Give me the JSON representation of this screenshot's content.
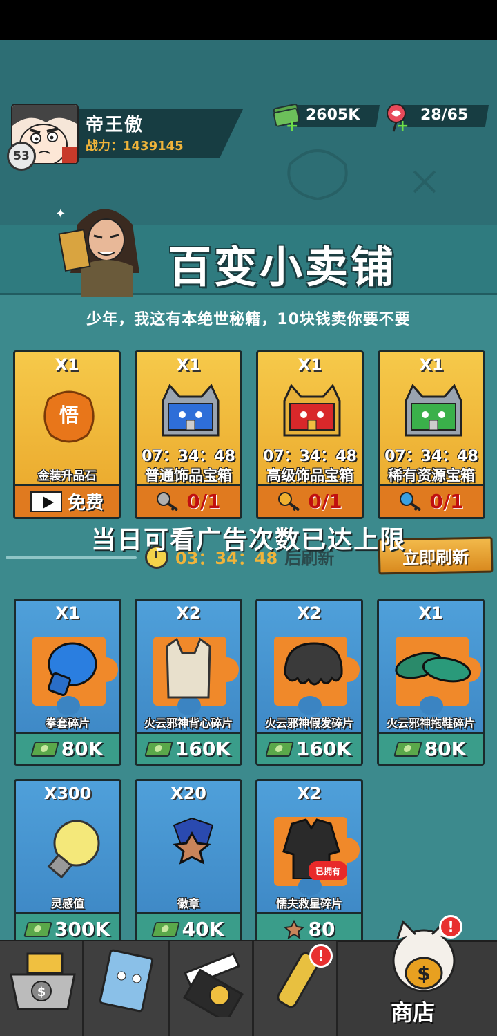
{
  "player": {
    "name": "帝王傲",
    "power_label": "战力：",
    "power": "1439145",
    "level": "53"
  },
  "resources": {
    "cash": "2605K",
    "lollipop": "28/65"
  },
  "shop": {
    "title": "百变小卖铺",
    "subtitle": "少年，我这有本绝世秘籍，10块钱卖你要不要",
    "special_items": [
      {
        "qty": "X1",
        "name": "金装升品石",
        "timer": "",
        "footer": "免费",
        "footer_type": "ad"
      },
      {
        "qty": "X1",
        "name": "普通饰品宝箱",
        "timer": "07：34：48",
        "footer": "0/1",
        "footer_type": "key",
        "key_color": "#b0b0b0"
      },
      {
        "qty": "X1",
        "name": "高级饰品宝箱",
        "timer": "07：34：48",
        "footer": "0/1",
        "footer_type": "key",
        "key_color": "#f0b030"
      },
      {
        "qty": "X1",
        "name": "稀有资源宝箱",
        "timer": "07：34：48",
        "footer": "0/1",
        "footer_type": "key",
        "key_color": "#3aa0e0"
      }
    ],
    "notice": "当日可看广告次数已达上限",
    "refresh_timer": "03：34：48",
    "refresh_label": "后刷新",
    "refresh_button": "立即刷新",
    "items": [
      {
        "qty": "X1",
        "name": "拳套碎片",
        "price": "80K"
      },
      {
        "qty": "X2",
        "name": "火云邪神背心碎片",
        "price": "160K"
      },
      {
        "qty": "X2",
        "name": "火云邪神假发碎片",
        "price": "160K"
      },
      {
        "qty": "X1",
        "name": "火云邪神拖鞋碎片",
        "price": "80K"
      },
      {
        "qty": "X300",
        "name": "灵感值",
        "price": "300K"
      },
      {
        "qty": "X20",
        "name": "徽章",
        "price": "40K"
      },
      {
        "qty": "X2",
        "name": "懦夫救星碎片",
        "price": "80",
        "owned": "已拥有"
      }
    ]
  },
  "nav": {
    "shop_label": "商店",
    "alert": "!"
  },
  "colors": {
    "gold_card": "#f6c94a",
    "blue_card": "#4fa0da",
    "panel": "#3c8a8d",
    "accent_text": "#f0b43a"
  }
}
